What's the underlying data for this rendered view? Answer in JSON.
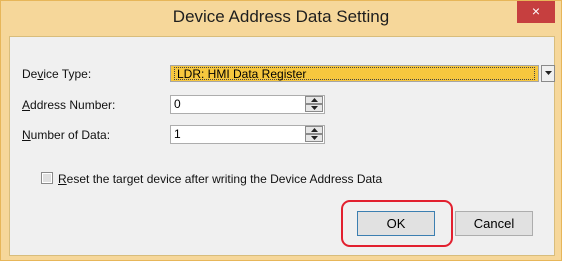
{
  "dialog": {
    "title": "Device Address Data Setting",
    "close_glyph": "×"
  },
  "device_type": {
    "label_pre": "De",
    "label_key": "v",
    "label_post": "ice Type:",
    "value": "LDR: HMI Data Register"
  },
  "address_number": {
    "label_key": "A",
    "label_post": "ddress Number:",
    "value": "0"
  },
  "number_of_data": {
    "label_key": "N",
    "label_post": "umber of Data:",
    "value": "1"
  },
  "reset_option": {
    "label_key": "R",
    "label_post": "eset the target device after writing the Device Address Data",
    "checked": false
  },
  "buttons": {
    "ok": "OK",
    "cancel": "Cancel"
  },
  "colors": {
    "title_bar": "#f6d79a",
    "close_button": "#c63f3f",
    "combo_selected": "#f7c73e",
    "highlight_annotation": "#e2202f"
  }
}
